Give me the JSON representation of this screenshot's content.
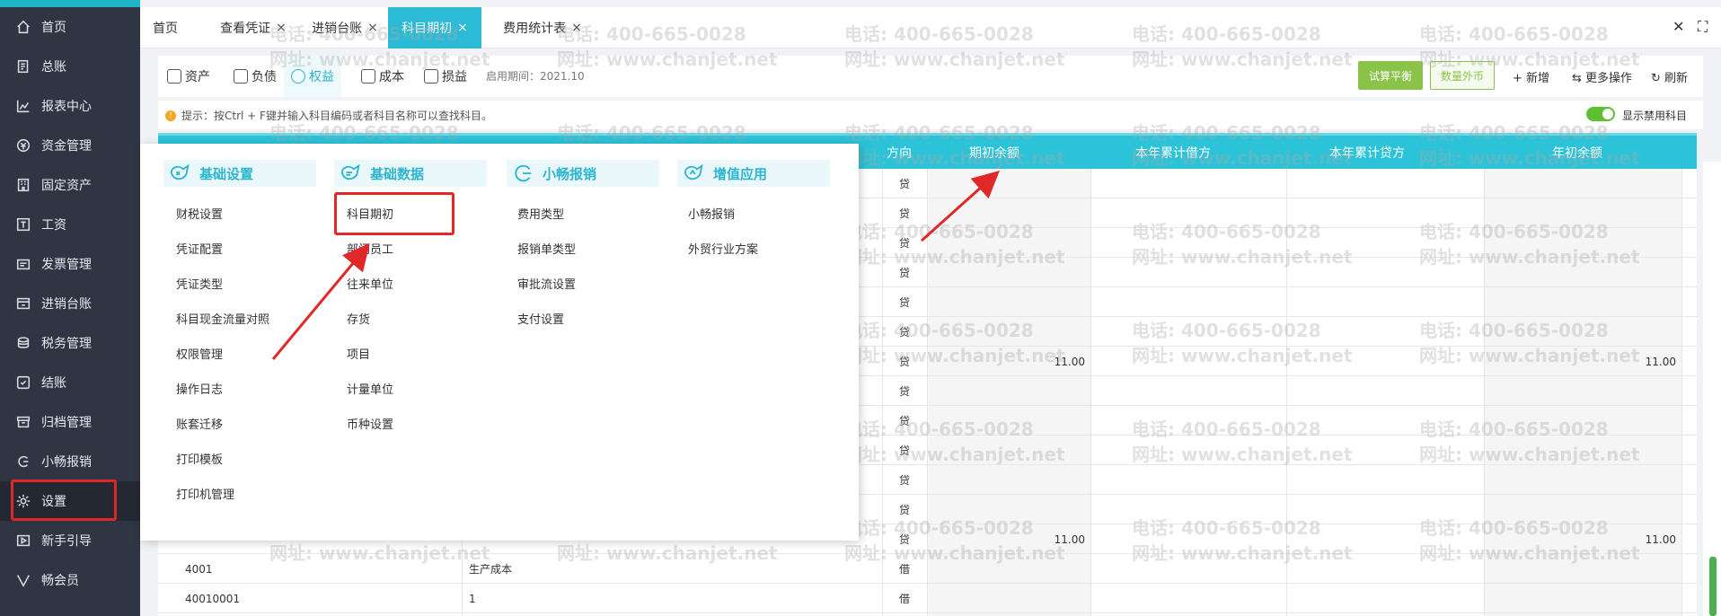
{
  "sidebar": {
    "items": [
      {
        "label": "首页",
        "icon": "home-icon"
      },
      {
        "label": "总账",
        "icon": "ledger-icon"
      },
      {
        "label": "报表中心",
        "icon": "chart-icon"
      },
      {
        "label": "资金管理",
        "icon": "money-icon"
      },
      {
        "label": "固定资产",
        "icon": "building-icon"
      },
      {
        "label": "工资",
        "icon": "salary-icon"
      },
      {
        "label": "发票管理",
        "icon": "invoice-icon"
      },
      {
        "label": "进销台账",
        "icon": "inventory-icon"
      },
      {
        "label": "税务管理",
        "icon": "tax-icon"
      },
      {
        "label": "结账",
        "icon": "checkout-icon"
      },
      {
        "label": "归档管理",
        "icon": "archive-icon"
      },
      {
        "label": "小畅报销",
        "icon": "reimburse-icon"
      },
      {
        "label": "设置",
        "icon": "gear-icon"
      },
      {
        "label": "新手引导",
        "icon": "guide-icon"
      },
      {
        "label": "畅会员",
        "icon": "vip-icon"
      }
    ]
  },
  "tabs": [
    {
      "label": "首页",
      "closable": false
    },
    {
      "label": "查看凭证",
      "closable": true
    },
    {
      "label": "进销台账",
      "closable": true
    },
    {
      "label": "科目期初",
      "closable": true,
      "active": true
    },
    {
      "label": "费用统计表",
      "closable": true
    }
  ],
  "tab_close_glyph": "×",
  "window_controls": {
    "close": "✕",
    "fullscreen": "⛶"
  },
  "subtabs": [
    {
      "label": "资产"
    },
    {
      "label": "负债"
    },
    {
      "label": "权益",
      "active": true
    },
    {
      "label": "成本"
    },
    {
      "label": "损益"
    }
  ],
  "period_text": "启用期间：2021.10",
  "toolbar": {
    "trial_balance": "试算平衡",
    "quantity_fx": "数量外币",
    "add": "+ 新增",
    "more": "更多操作",
    "refresh": "刷新"
  },
  "tip": {
    "icon": "!",
    "text": "提示：按Ctrl + F键并输入科目编码或者科目名称可以查找科目。"
  },
  "toggle_label": "显示禁用科目",
  "table": {
    "headers": {
      "direction": "方向",
      "opening_balance": "期初余额",
      "year_debit": "本年累计借方",
      "year_credit": "本年累计贷方",
      "year_start_balance": "年初余额"
    },
    "rows": [
      {
        "dir": "贷",
        "opening": "",
        "start": ""
      },
      {
        "dir": "贷",
        "opening": "",
        "start": ""
      },
      {
        "dir": "贷",
        "opening": "",
        "start": ""
      },
      {
        "dir": "贷",
        "opening": "",
        "start": ""
      },
      {
        "dir": "贷",
        "opening": "",
        "start": ""
      },
      {
        "dir": "贷",
        "opening": "",
        "start": ""
      },
      {
        "dir": "贷",
        "opening": "11.00",
        "start": "11.00"
      },
      {
        "dir": "贷",
        "opening": "",
        "start": ""
      },
      {
        "dir": "贷",
        "opening": "",
        "start": ""
      },
      {
        "dir": "贷",
        "opening": "",
        "start": ""
      },
      {
        "dir": "贷",
        "opening": "",
        "start": ""
      },
      {
        "dir": "贷",
        "opening": "",
        "start": ""
      },
      {
        "dir": "贷",
        "opening": "11.00",
        "start": "11.00"
      },
      {
        "code": "4001",
        "name": "生产成本",
        "dir": "借",
        "opening": "",
        "start": ""
      },
      {
        "code": "40010001",
        "name": "1",
        "dir": "借",
        "opening": "",
        "start": ""
      }
    ]
  },
  "watermark": {
    "phone": "电话: 400-665-0028",
    "site": "网址: www.chanjet.net"
  },
  "settings_panel": {
    "columns": [
      {
        "title": "基础设置",
        "icon": "basic-settings-icon",
        "items": [
          "财税设置",
          "凭证配置",
          "凭证类型",
          "科目现金流量对照",
          "权限管理",
          "操作日志",
          "账套迁移",
          "打印模板",
          "打印机管理"
        ]
      },
      {
        "title": "基础数据",
        "icon": "basic-data-icon",
        "items": [
          "科目期初",
          "部门员工",
          "往来单位",
          "存货",
          "项目",
          "计量单位",
          "币种设置"
        ]
      },
      {
        "title": "小畅报销",
        "icon": "reimburse-logo-icon",
        "items": [
          "费用类型",
          "报销单类型",
          "审批流设置",
          "支付设置"
        ]
      },
      {
        "title": "增值应用",
        "icon": "value-added-icon",
        "items": [
          "小畅报销",
          "外贸行业方案"
        ]
      }
    ]
  },
  "colors": {
    "accent": "#2bbbd6",
    "sidebar_bg": "#2f3542",
    "green_button": "#8bc34a",
    "highlight": "#e02828"
  }
}
